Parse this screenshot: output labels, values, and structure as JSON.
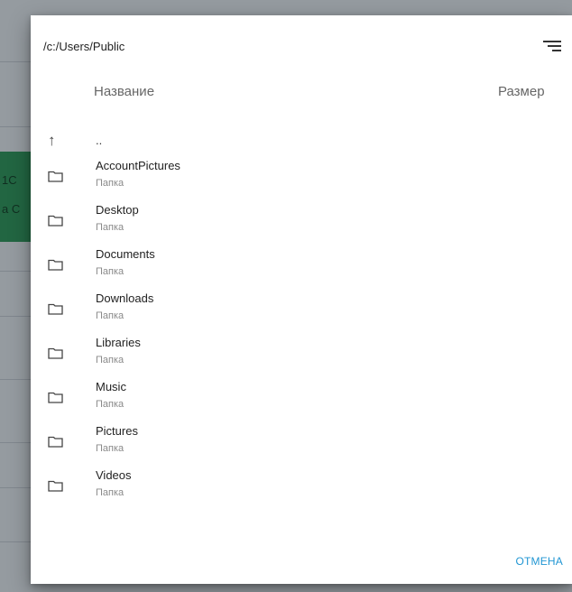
{
  "background": {
    "green_text_1": "1C",
    "green_text_2": "a C"
  },
  "dialog": {
    "path": "/c:/Users/Public",
    "sort_icon": "sort-icon",
    "columns": {
      "name": "Название",
      "size": "Размер"
    },
    "parent_label": "..",
    "parent_icon": "arrow-up-icon",
    "items": [
      {
        "name": "AccountPictures",
        "type": "Папка"
      },
      {
        "name": "Desktop",
        "type": "Папка"
      },
      {
        "name": "Documents",
        "type": "Папка"
      },
      {
        "name": "Downloads",
        "type": "Папка"
      },
      {
        "name": "Libraries",
        "type": "Папка"
      },
      {
        "name": "Music",
        "type": "Папка"
      },
      {
        "name": "Pictures",
        "type": "Папка"
      },
      {
        "name": "Videos",
        "type": "Папка"
      }
    ],
    "cancel_label": "ОТМЕНА",
    "accent_color": "#2196d3"
  }
}
